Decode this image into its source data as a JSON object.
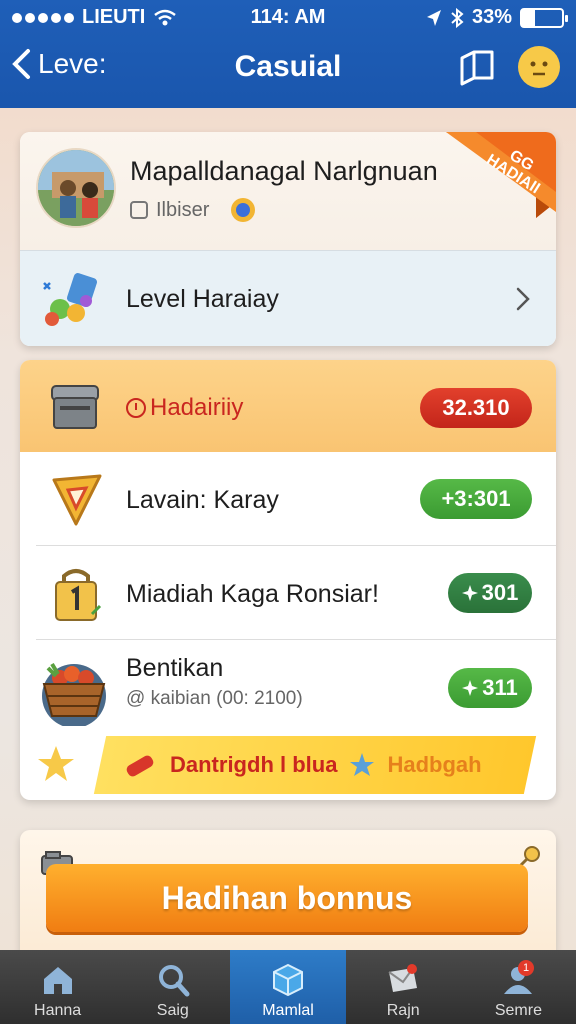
{
  "status_bar": {
    "carrier": "LIEUTI",
    "time": "114: AM",
    "battery": "33%"
  },
  "app_bar": {
    "back_label": "Leve:",
    "title": "Casuial"
  },
  "profile": {
    "name": "Mapalldanagal Narlgnuan",
    "subtitle": "Ilbiser",
    "ribbon": "GG HADIAII"
  },
  "level_row": {
    "label": "Level Haraiay"
  },
  "rewards": {
    "header": {
      "label": "Hadairiiy",
      "value": "32.310"
    },
    "rows": [
      {
        "label": "Lavain: Karay",
        "value": "+3:301"
      },
      {
        "label": "Miadiah Kaga Ronsiar!",
        "value": "301"
      },
      {
        "label": "Bentikan",
        "sub": "kaibian (00: 2100)",
        "value": "311"
      }
    ],
    "banner": {
      "left": "Dantrigdh l blua",
      "right": "Hadbgah"
    }
  },
  "bonus": {
    "label": "Hadihan bonnus"
  },
  "nav": [
    {
      "label": "Hanna",
      "icon": "home-icon"
    },
    {
      "label": "Saig",
      "icon": "search-icon"
    },
    {
      "label": "Mamlal",
      "icon": "box-icon"
    },
    {
      "label": "Rajn",
      "icon": "mail-icon"
    },
    {
      "label": "Semre",
      "icon": "profile-icon",
      "badge": "1"
    }
  ],
  "colors": {
    "app_bar": "#1a56ad",
    "accent_orange": "#f07d12",
    "pill_red": "#c3251a",
    "pill_green": "#3b9b32",
    "nav_active": "#1f5fa8"
  }
}
